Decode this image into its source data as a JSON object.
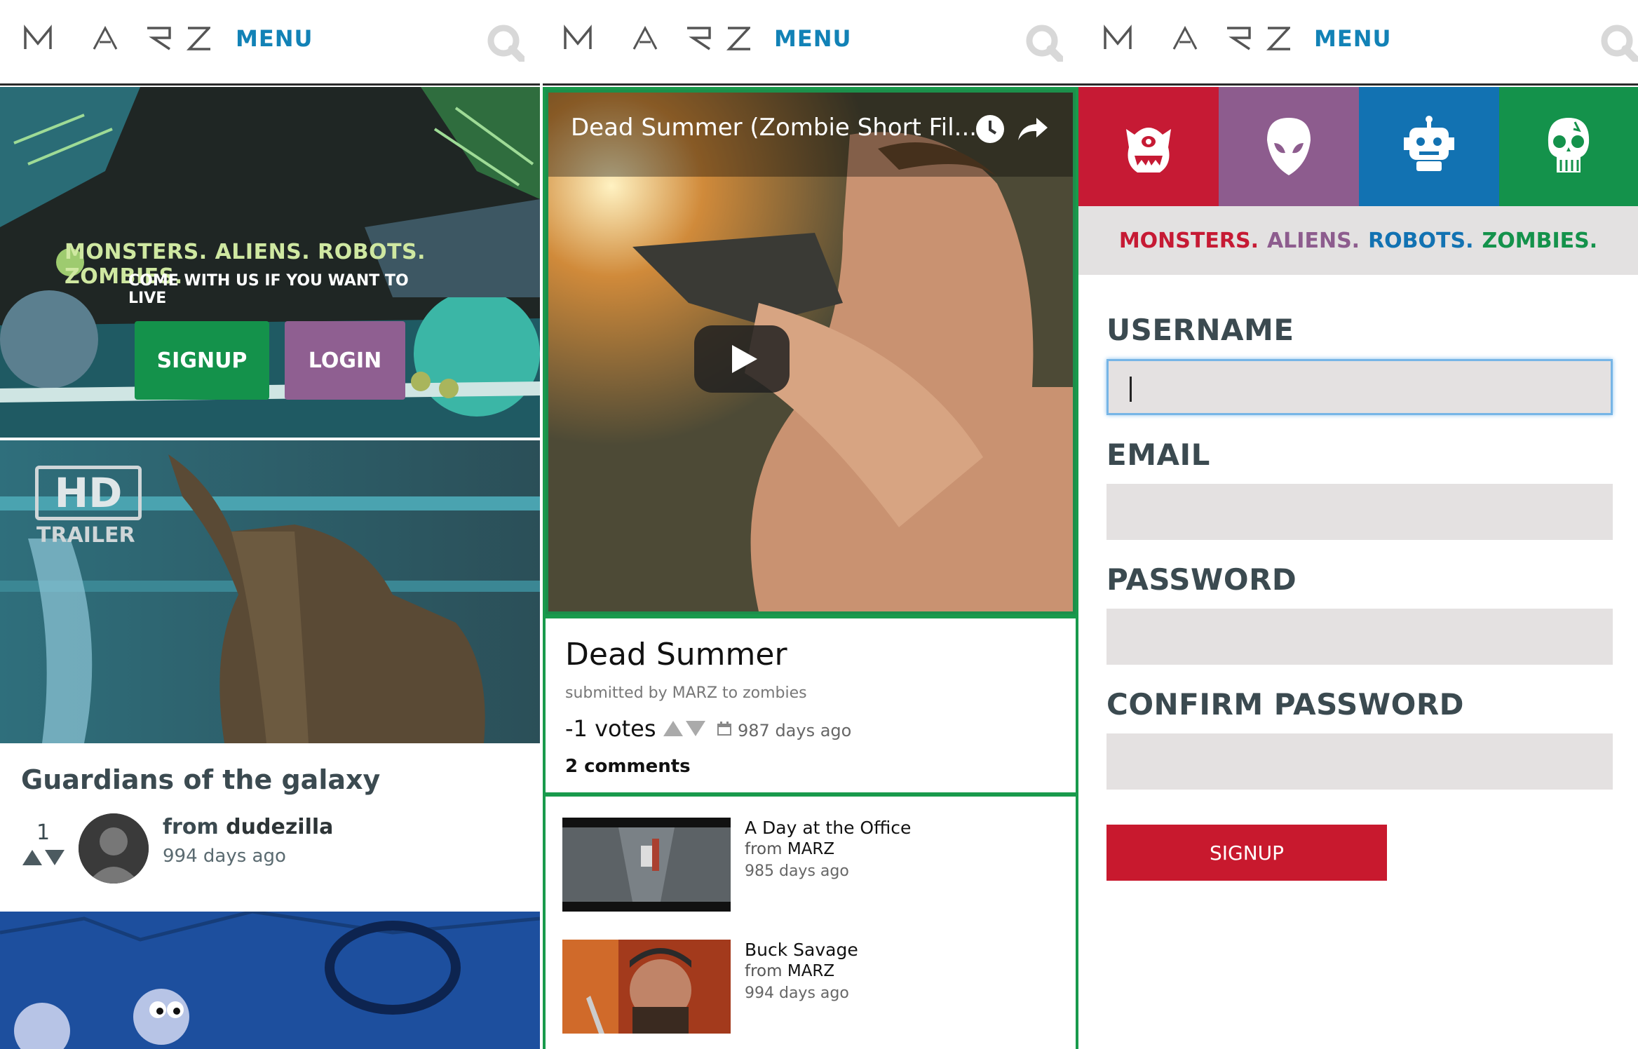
{
  "brand": {
    "logo_text": "MARZ",
    "menu_label": "MENU",
    "accent": "#1282b6"
  },
  "hero": {
    "title": "MONSTERS. ALIENS. ROBOTS. ZOMBIES.",
    "subtitle": "COME WITH US IF YOU WANT TO LIVE",
    "signup_label": "SIGNUP",
    "login_label": "LOGIN"
  },
  "feed": {
    "trailer_badge": "HD",
    "trailer_badge_sub": "TRAILER",
    "card": {
      "title": "Guardians of the galaxy",
      "votes": "1",
      "from_label": "from",
      "user": "dudezilla",
      "age": "994 days ago"
    }
  },
  "video": {
    "title": "Dead Summer (Zombie Short Fil...",
    "post_title": "Dead Summer",
    "submitted": "submitted by MARZ to zombies",
    "votes": "-1 votes",
    "age": "987 days ago",
    "comments": "2 comments"
  },
  "related": [
    {
      "title": "A Day at the Office",
      "from_label": "from",
      "user": "MARZ",
      "age": "985 days ago"
    },
    {
      "title": "Buck Savage",
      "from_label": "from",
      "user": "MARZ",
      "age": "994 days ago"
    }
  ],
  "signup_form": {
    "categories": [
      {
        "name": "monster-icon",
        "color": "#c61a34"
      },
      {
        "name": "alien-icon",
        "color": "#8d5c8e"
      },
      {
        "name": "robot-icon",
        "color": "#1272b2"
      },
      {
        "name": "zombie-skull-icon",
        "color": "#14924b"
      }
    ],
    "tagline": {
      "monsters": "MONSTERS.",
      "aliens": "ALIENS.",
      "robots": "ROBOTS.",
      "zombies": "ZOMBIES."
    },
    "username_label": "USERNAME",
    "email_label": "EMAIL",
    "password_label": "PASSWORD",
    "confirm_label": "CONFIRM PASSWORD",
    "username_value": "",
    "email_value": "",
    "password_value": "",
    "confirm_value": "",
    "submit_label": "SIGNUP"
  }
}
